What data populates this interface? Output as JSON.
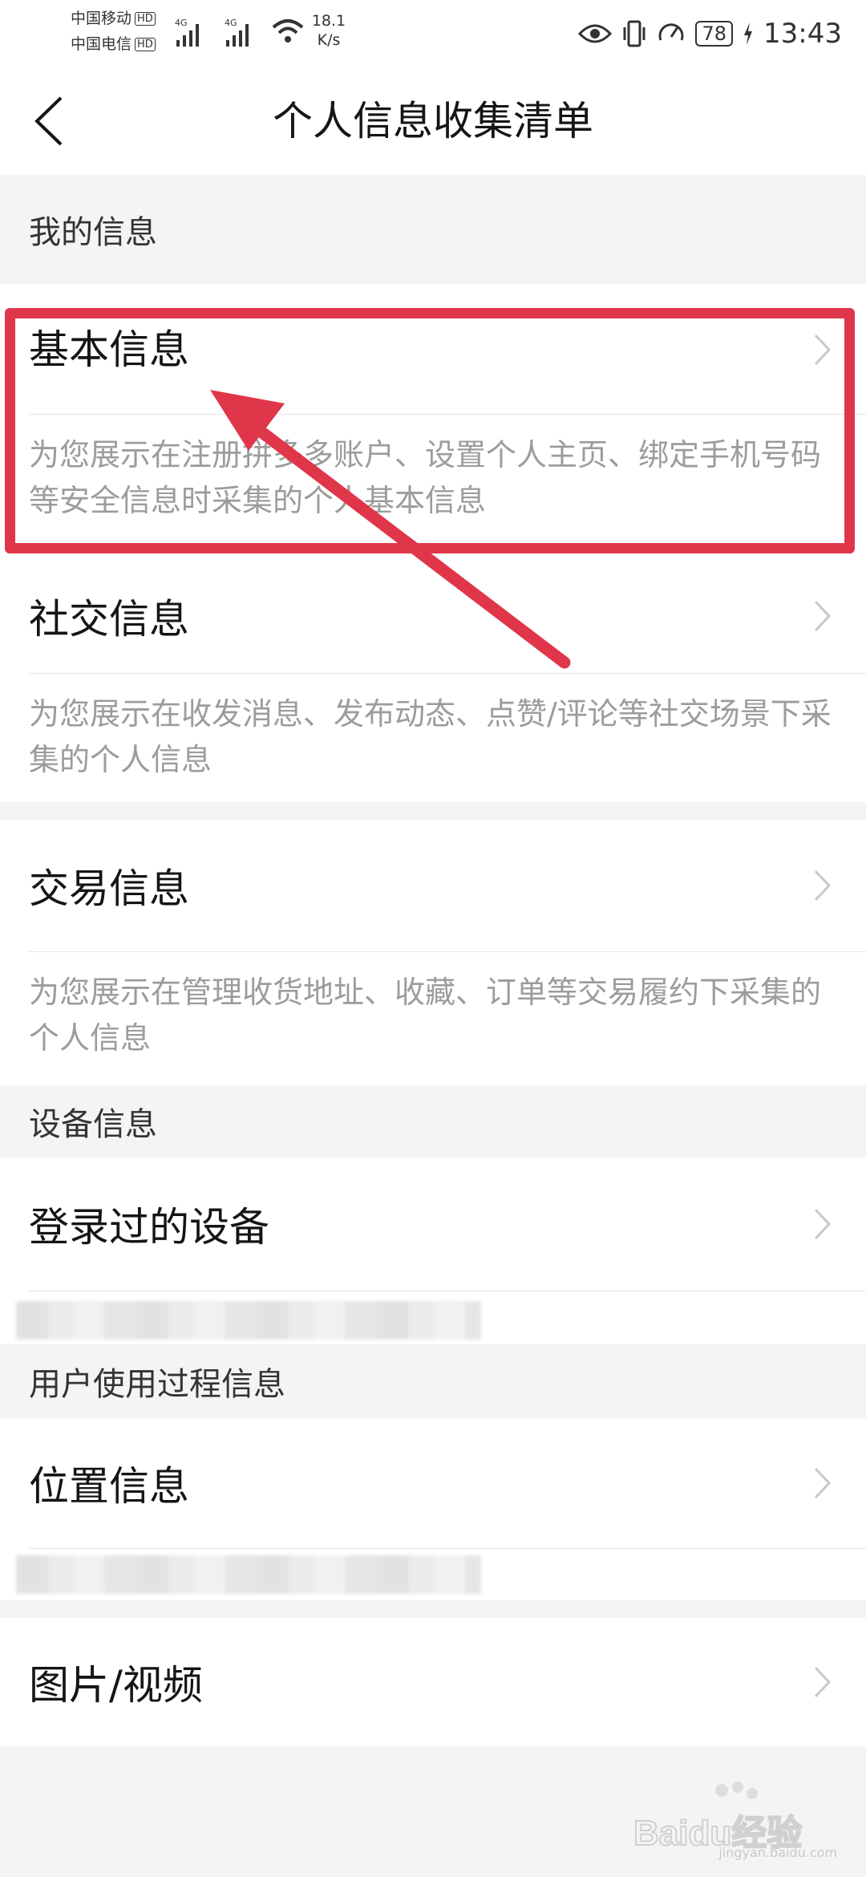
{
  "status_bar": {
    "carrier_1": "中国移动",
    "carrier_2": "中国电信",
    "hd_badge": "HD",
    "network_type": "4G",
    "speed_value": "18.1",
    "speed_unit": "K/s",
    "battery": "78",
    "time": "13:43"
  },
  "header": {
    "title": "个人信息收集清单",
    "back_icon": "back-arrow-icon"
  },
  "sections": {
    "my_info": {
      "header": "我的信息",
      "basic": {
        "title": "基本信息",
        "desc": "为您展示在注册拼多多账户、设置个人主页、绑定手机号码等安全信息时采集的个人基本信息"
      },
      "social": {
        "title": "社交信息",
        "desc": "为您展示在收发消息、发布动态、点赞/评论等社交场景下采集的个人信息"
      },
      "trade": {
        "title": "交易信息",
        "desc": "为您展示在管理收货地址、收藏、订单等交易履约下采集的个人信息"
      }
    },
    "device_info": {
      "header": "设备信息",
      "devices": {
        "title": "登录过的设备"
      }
    },
    "usage_info": {
      "header": "用户使用过程信息",
      "location": {
        "title": "位置信息"
      },
      "media": {
        "title": "图片/视频"
      }
    }
  },
  "watermark": {
    "logo": "Baidu经验",
    "url": "jingyan.baidu.com"
  },
  "colors": {
    "annotation": "#e0364a",
    "background": "#f4f4f4",
    "desc_text": "#9c9c9c"
  }
}
